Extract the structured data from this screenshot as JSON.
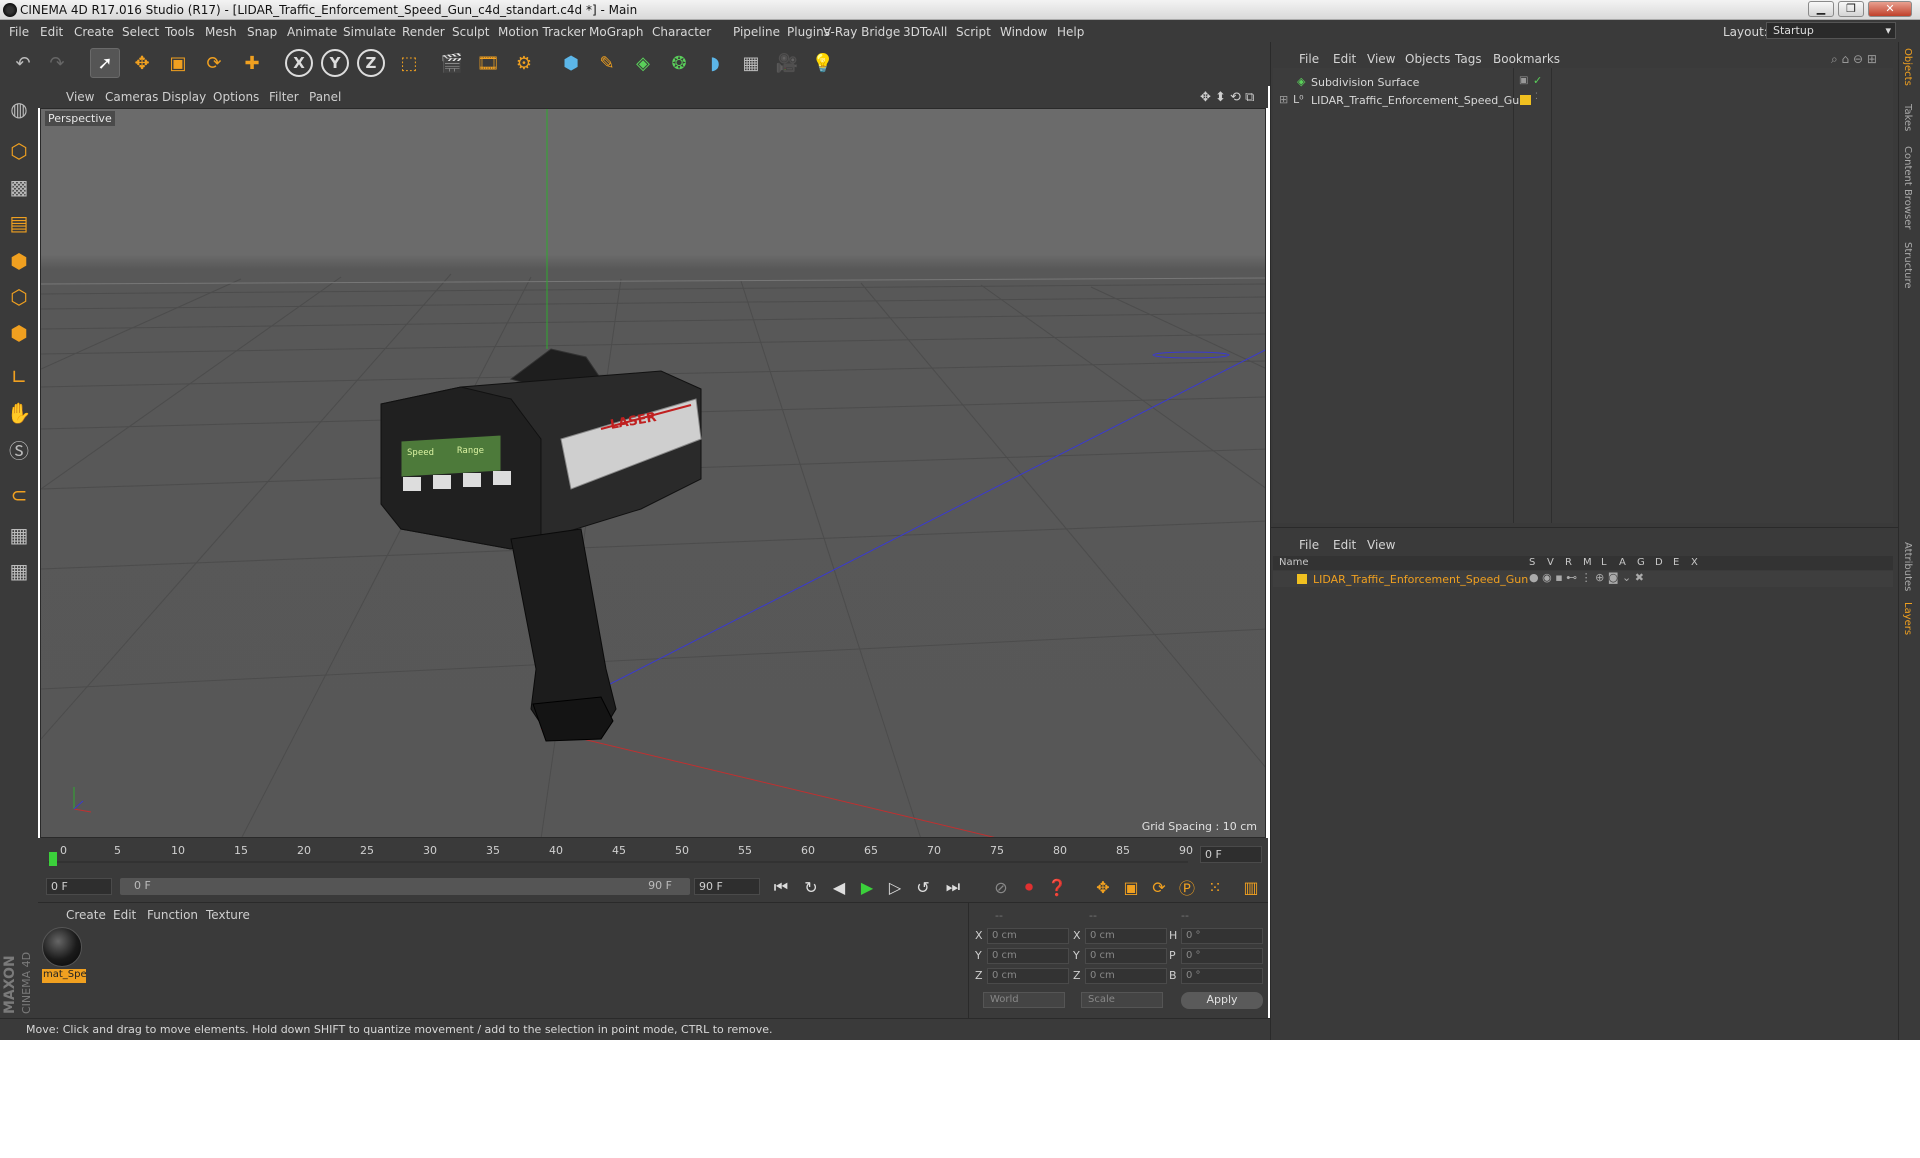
{
  "window": {
    "title": "CINEMA 4D R17.016 Studio (R17) - [LIDAR_Traffic_Enforcement_Speed_Gun_c4d_standart.c4d *] - Main",
    "min": "▁",
    "max": "❐",
    "close": "✕"
  },
  "menubar": {
    "items": [
      "File",
      "Edit",
      "Create",
      "Select",
      "Tools",
      "Mesh",
      "Snap",
      "Animate",
      "Simulate",
      "Render",
      "Sculpt",
      "Motion Tracker",
      "MoGraph",
      "Character",
      "Pipeline",
      "Plugins",
      "V-Ray Bridge",
      "3DToAll",
      "Script",
      "Window",
      "Help"
    ],
    "layout_label": "Layout:",
    "layout_value": "Startup"
  },
  "toolbar": {
    "icons": [
      "undo-icon",
      "redo-icon",
      "live-selection-icon",
      "move-icon",
      "scale-icon",
      "rotate-icon",
      "move-alt-icon",
      "x-axis-icon",
      "y-axis-icon",
      "z-axis-icon",
      "world-coords-icon",
      "render-view-icon",
      "render-picture-viewer-icon",
      "render-settings-icon",
      "cube-primitive-icon",
      "spline-pen-icon",
      "subdivision-icon",
      "mograph-cloner-icon",
      "deformer-icon",
      "floor-icon",
      "camera-icon",
      "light-icon"
    ],
    "axis_x": "X",
    "axis_y": "Y",
    "axis_z": "Z"
  },
  "viewport": {
    "menu": [
      "View",
      "Cameras",
      "Display",
      "Options",
      "Filter",
      "Panel"
    ],
    "label": "Perspective",
    "grid_spacing": "Grid Spacing : 10 cm",
    "device_display": {
      "speed": "Speed",
      "range": "Range",
      "brand": "LASER"
    }
  },
  "timeline": {
    "ticks": [
      "0",
      "5",
      "10",
      "15",
      "20",
      "25",
      "30",
      "35",
      "40",
      "45",
      "50",
      "55",
      "60",
      "65",
      "70",
      "75",
      "80",
      "85",
      "90"
    ],
    "current_frame": "0 F",
    "start_field": "0 F",
    "range_start": "0 F",
    "range_end": "90 F",
    "end_field": "90 F"
  },
  "material_manager": {
    "menu": [
      "Create",
      "Edit",
      "Function",
      "Texture"
    ],
    "material_name": "mat_Spe"
  },
  "coordinates": {
    "col_headers": [
      "--",
      "--",
      "--"
    ],
    "rows": [
      {
        "a": "X",
        "a_val": "0 cm",
        "b": "X",
        "b_val": "0 cm",
        "c": "H",
        "c_val": "0 °"
      },
      {
        "a": "Y",
        "a_val": "0 cm",
        "b": "Y",
        "b_val": "0 cm",
        "c": "P",
        "c_val": "0 °"
      },
      {
        "a": "Z",
        "a_val": "0 cm",
        "b": "Z",
        "b_val": "0 cm",
        "c": "B",
        "c_val": "0 °"
      }
    ],
    "mode": "World",
    "scale": "Scale",
    "apply": "Apply"
  },
  "status": "Move: Click and drag to move elements. Hold down SHIFT to quantize movement / add to the selection in point mode, CTRL to remove.",
  "object_manager": {
    "menu": [
      "File",
      "Edit",
      "View",
      "Objects",
      "Tags",
      "Bookmarks"
    ],
    "objects": [
      {
        "name": "Subdivision Surface"
      },
      {
        "name": "LIDAR_Traffic_Enforcement_Speed_Gun"
      }
    ]
  },
  "layer_manager": {
    "menu": [
      "File",
      "Edit",
      "View"
    ],
    "col_name": "Name",
    "cols": [
      "S",
      "V",
      "R",
      "M",
      "L",
      "A",
      "G",
      "D",
      "E",
      "X"
    ],
    "layers": [
      {
        "name": "LIDAR_Traffic_Enforcement_Speed_Gun",
        "color": "#f0c020"
      }
    ]
  },
  "right_tabs": [
    "Objects",
    "Takes",
    "Content Browser",
    "Structure",
    "Attributes",
    "Layers"
  ],
  "logo": {
    "line1": "MAXON",
    "line2": "CINEMA 4D"
  },
  "colors": {
    "accent": "#f0a020",
    "panel": "#3a3a3a",
    "x_axis": "#c03030",
    "y_axis": "#30a030",
    "z_axis": "#3040c0"
  }
}
